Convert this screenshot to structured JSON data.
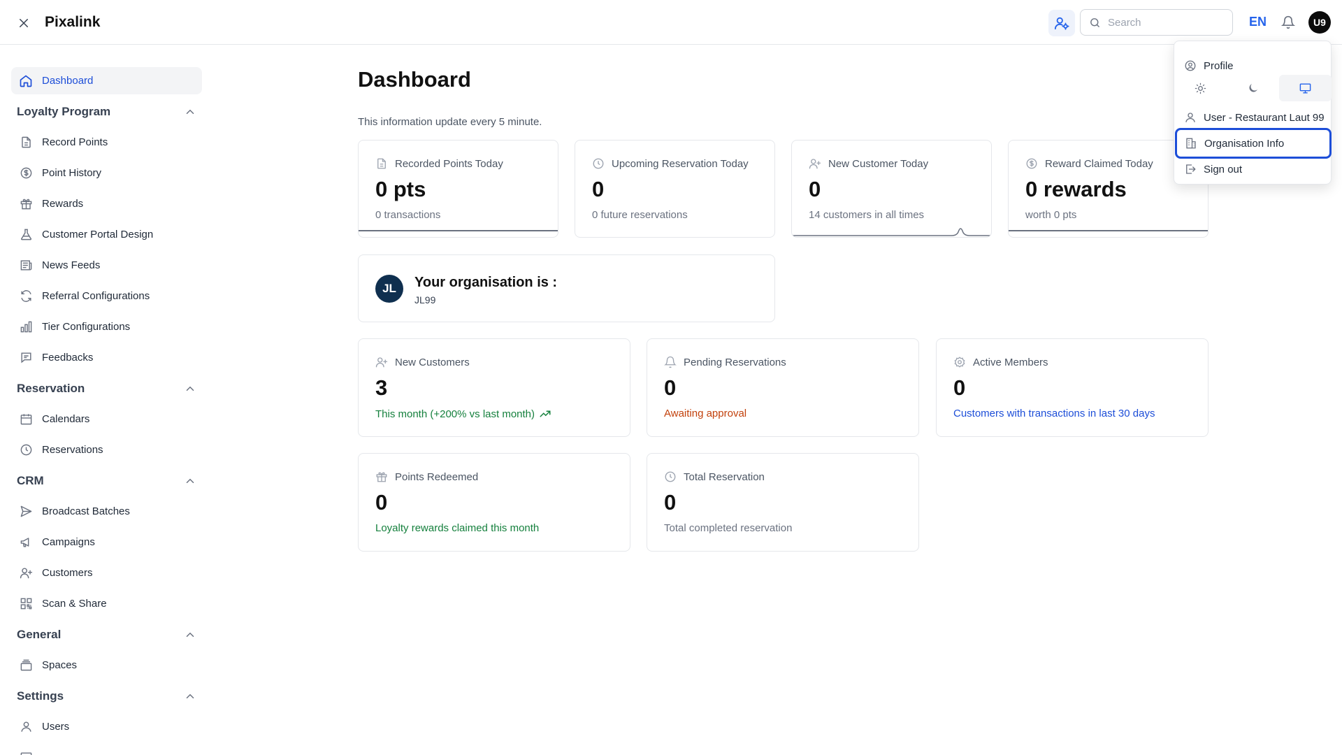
{
  "app": {
    "title": "Pixalink"
  },
  "header": {
    "search_placeholder": "Search",
    "language": "EN",
    "avatar_initials": "U9"
  },
  "sidebar": {
    "dashboard": "Dashboard",
    "sections": {
      "loyalty": "Loyalty Program",
      "reservation": "Reservation",
      "crm": "CRM",
      "general": "General",
      "settings": "Settings"
    },
    "items": {
      "record_points": "Record Points",
      "point_history": "Point History",
      "rewards": "Rewards",
      "customer_portal_design": "Customer Portal Design",
      "news_feeds": "News Feeds",
      "referral_configurations": "Referral Configurations",
      "tier_configurations": "Tier Configurations",
      "feedbacks": "Feedbacks",
      "calendars": "Calendars",
      "reservations": "Reservations",
      "broadcast_batches": "Broadcast Batches",
      "campaigns": "Campaigns",
      "customers": "Customers",
      "scan_share": "Scan & Share",
      "spaces": "Spaces",
      "users": "Users"
    }
  },
  "main": {
    "title": "Dashboard",
    "update_note": "This information update every 5 minute.",
    "stats_today": [
      {
        "label": "Recorded Points Today",
        "value": "0 pts",
        "sub": "0 transactions"
      },
      {
        "label": "Upcoming Reservation Today",
        "value": "0",
        "sub": "0 future reservations"
      },
      {
        "label": "New Customer Today",
        "value": "0",
        "sub": "14 customers in all times"
      },
      {
        "label": "Reward Claimed Today",
        "value": "0 rewards",
        "sub": "worth 0 pts"
      }
    ],
    "organisation": {
      "initials": "JL",
      "title": "Your organisation is :",
      "code": "JL99"
    },
    "stats_month": [
      {
        "label": "New Customers",
        "value": "3",
        "sub": "This month (+200% vs last month)"
      },
      {
        "label": "Pending Reservations",
        "value": "0",
        "sub": "Awaiting approval"
      },
      {
        "label": "Active Members",
        "value": "0",
        "sub": "Customers with transactions in last 30 days"
      },
      {
        "label": "Points Redeemed",
        "value": "0",
        "sub": "Loyalty rewards claimed this month"
      },
      {
        "label": "Total Reservation",
        "value": "0",
        "sub": "Total completed reservation"
      }
    ]
  },
  "user_menu": {
    "profile": "Profile",
    "theme_options": [
      "light-theme",
      "dark-theme",
      "system-theme"
    ],
    "selected_theme": "system-theme",
    "user_label": "User - Restaurant Laut 99",
    "organisation_info": "Organisation Info",
    "sign_out": "Sign out"
  },
  "colors": {
    "accent": "#1d4ed8",
    "positive": "#15803d",
    "warning": "#c2410c",
    "org_avatar": "#0f2f4f"
  }
}
